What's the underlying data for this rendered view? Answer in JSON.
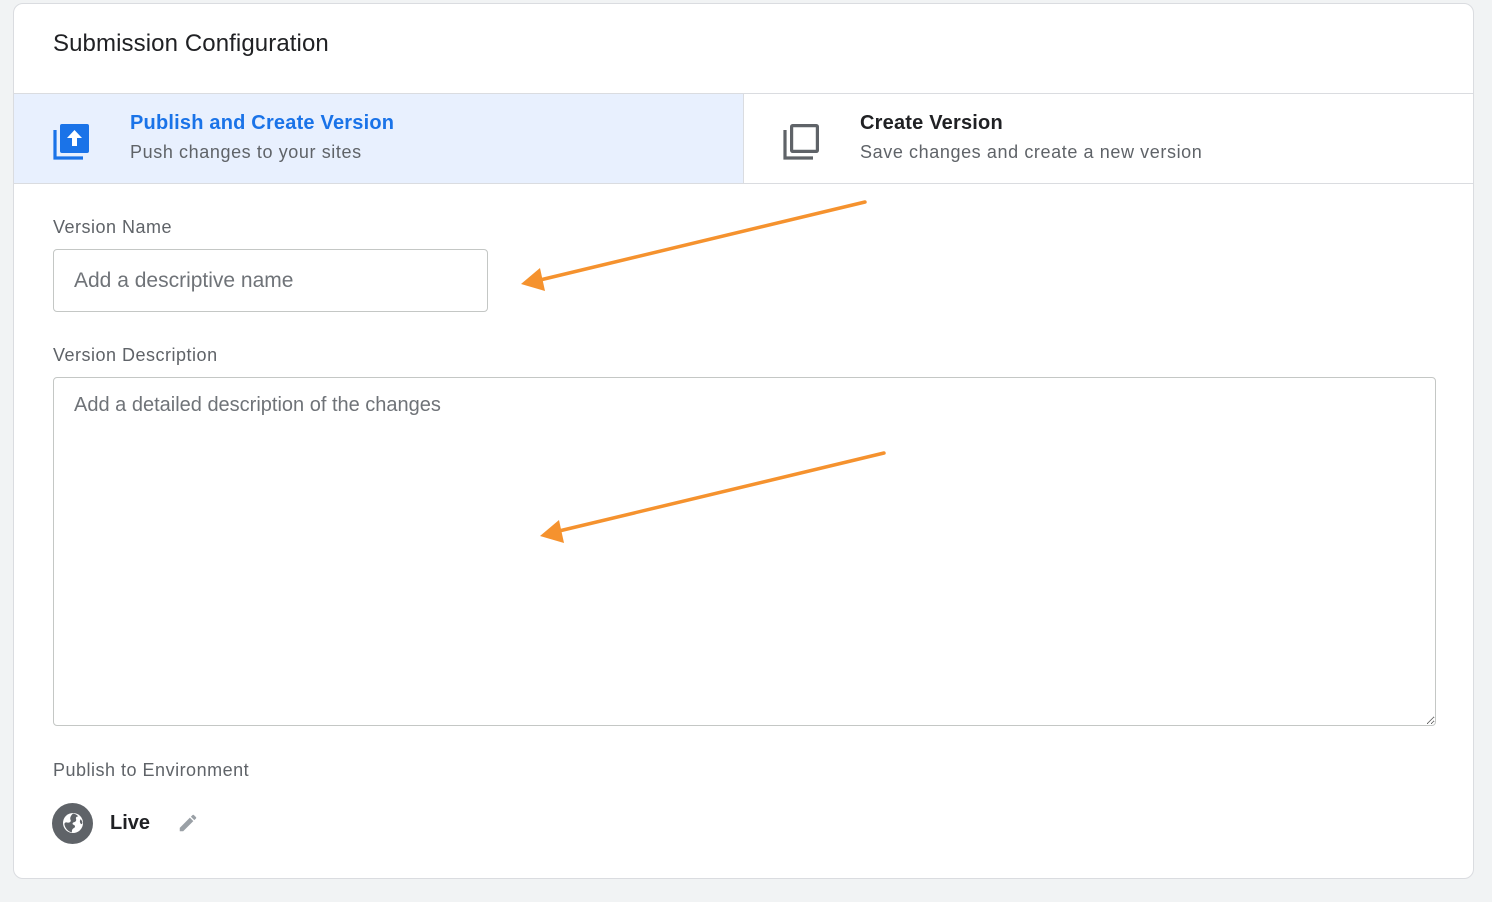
{
  "card": {
    "title": "Submission Configuration"
  },
  "options": {
    "selected": {
      "title": "Publish and Create Version",
      "subtitle": "Push changes to your sites",
      "icon": "publish-upload-icon"
    },
    "other": {
      "title": "Create Version",
      "subtitle": "Save changes and create a new version",
      "icon": "copy-version-icon"
    }
  },
  "version_name": {
    "label": "Version Name",
    "placeholder": "Add a descriptive name",
    "value": ""
  },
  "version_description": {
    "label": "Version Description",
    "placeholder": "Add a detailed description of the changes",
    "value": ""
  },
  "environment": {
    "label": "Publish to Environment",
    "name": "Live",
    "icon": "globe-icon",
    "edit_icon": "pencil-icon"
  },
  "colors": {
    "accent": "#1a73e8",
    "selected_bg": "#e8f0fe",
    "annotation_arrow": "#f5922e",
    "env_icon_bg": "#5f6368"
  }
}
